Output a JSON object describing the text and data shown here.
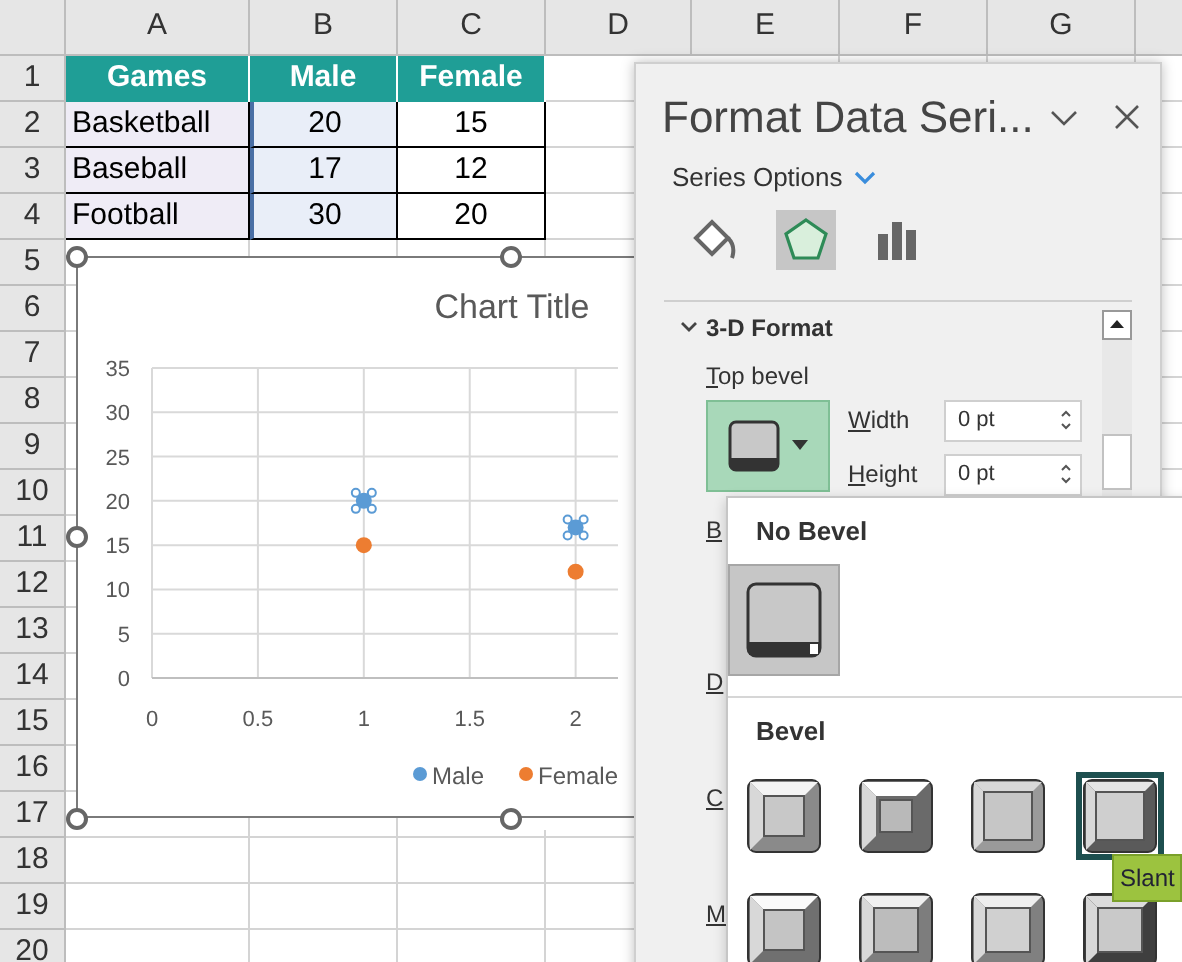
{
  "sheet": {
    "columns": [
      "A",
      "B",
      "C",
      "D",
      "E",
      "F",
      "G"
    ],
    "rows": [
      "1",
      "2",
      "3",
      "4",
      "5",
      "6",
      "7",
      "8",
      "9",
      "10",
      "11",
      "12",
      "13",
      "14",
      "15",
      "16",
      "17",
      "18",
      "19",
      "20"
    ]
  },
  "table": {
    "columns": [
      "Games",
      "Male",
      "Female"
    ],
    "rows": [
      [
        "Basketball",
        "20",
        "15"
      ],
      [
        "Baseball",
        "17",
        "12"
      ],
      [
        "Football",
        "30",
        "20"
      ]
    ]
  },
  "chart": {
    "chart_data": {
      "type": "scatter",
      "title": "Chart Title",
      "x": [
        1,
        2
      ],
      "series": [
        {
          "name": "Male",
          "color": "#5b9bd5",
          "values": [
            20,
            17
          ]
        },
        {
          "name": "Female",
          "color": "#ed7d31",
          "values": [
            15,
            12
          ]
        }
      ],
      "xticks": [
        0,
        0.5,
        1,
        1.5,
        2
      ],
      "yticks": [
        0,
        5,
        10,
        15,
        20,
        25,
        30,
        35
      ],
      "xlim": [
        0,
        2.2
      ],
      "ylim": [
        0,
        35
      ],
      "grid": true,
      "legend": true
    },
    "series_state": [
      {
        "selected": true
      },
      {
        "selected": false
      }
    ]
  },
  "panel": {
    "title": "Format Data Seri...",
    "subtitle": "Series Options",
    "tabs": [
      {
        "kind": "fill",
        "selected": false
      },
      {
        "kind": "effects",
        "selected": true
      },
      {
        "kind": "options",
        "selected": false
      }
    ],
    "section": {
      "title": "3-D Format",
      "expanded": true
    },
    "top_bevel_label": "Top bevel",
    "width": {
      "label": "Width",
      "value": "0 pt"
    },
    "height": {
      "label": "Height",
      "value": "0 pt"
    },
    "hidden_labels": [
      "B",
      "D",
      "C",
      "M"
    ]
  },
  "bevel_menu": {
    "no_bevel": {
      "heading": "No Bevel",
      "selected": true
    },
    "bevel_heading": "Bevel",
    "tooltip": "Slant",
    "presets": [
      {
        "kind": "circle",
        "highlighted": false
      },
      {
        "kind": "relaxed",
        "highlighted": false
      },
      {
        "kind": "cross",
        "highlighted": false
      },
      {
        "kind": "slant",
        "highlighted": true
      },
      {
        "kind": "angle",
        "highlighted": false
      },
      {
        "kind": "soft",
        "highlighted": false
      },
      {
        "kind": "convex",
        "highlighted": false
      },
      {
        "kind": "slope",
        "highlighted": false
      }
    ]
  }
}
